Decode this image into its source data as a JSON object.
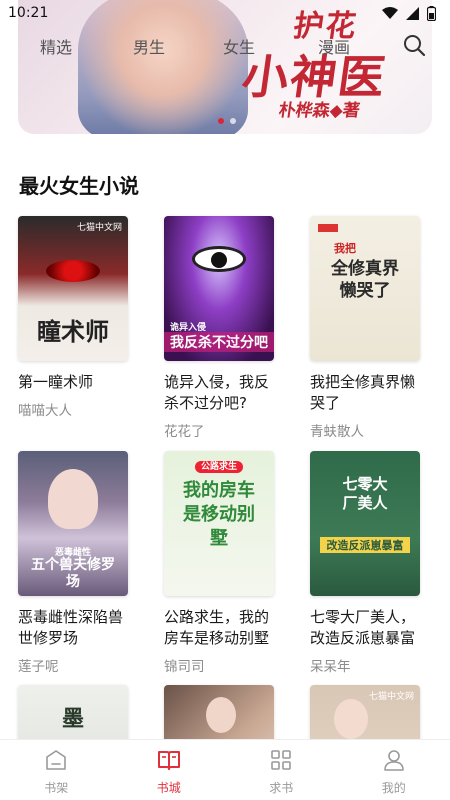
{
  "status_bar": {
    "time": "10:21"
  },
  "banner": {
    "title_line1": "护花",
    "title_line2": "小神医",
    "author": "朴桦森◆著"
  },
  "top_tabs": [
    "精选",
    "男生",
    "女生",
    "漫画"
  ],
  "section": {
    "title": "最火女生小说",
    "books": [
      {
        "title": "第一瞳术师",
        "author": "喵喵大人",
        "cover_text": "瞳术师",
        "cover_badge": "七猫中文网"
      },
      {
        "title": "诡异入侵，我反杀不过分吧?",
        "author": "花花了",
        "cover_text": "我反杀不过分吧",
        "cover_badge": "诡异入侵"
      },
      {
        "title": "我把全修真界懒哭了",
        "author": "青蚨散人",
        "cover_text": "全修真界懒哭了",
        "cover_badge": "我把"
      },
      {
        "title": "恶毒雌性深陷兽世修罗场",
        "author": "莲子呢",
        "cover_text": "五个兽夫修罗场",
        "cover_badge": "恶毒雌性"
      },
      {
        "title": "公路求生，我的房车是移动别墅",
        "author": "锦司司",
        "cover_text": "我的房车是移动别墅",
        "cover_badge": "公路求生"
      },
      {
        "title": "七零大厂美人，改造反派崽暴富",
        "author": "呆呆年",
        "cover_text": "七零大厂美人",
        "cover_badge": "改造反派崽暴富"
      },
      {
        "title": "",
        "author": "",
        "cover_text": "墨",
        "cover_badge": ""
      },
      {
        "title": "",
        "author": "",
        "cover_text": "",
        "cover_badge": ""
      },
      {
        "title": "",
        "author": "",
        "cover_text": "",
        "cover_badge": "七猫中文网"
      }
    ]
  },
  "bottom_nav": [
    {
      "label": "书架",
      "icon": "bookshelf-icon",
      "active": false
    },
    {
      "label": "书城",
      "icon": "bookstore-icon",
      "active": true
    },
    {
      "label": "求书",
      "icon": "grid-icon",
      "active": false
    },
    {
      "label": "我的",
      "icon": "profile-icon",
      "active": false
    }
  ],
  "colors": {
    "accent": "#e0303b",
    "muted": "#8c8c8c"
  }
}
